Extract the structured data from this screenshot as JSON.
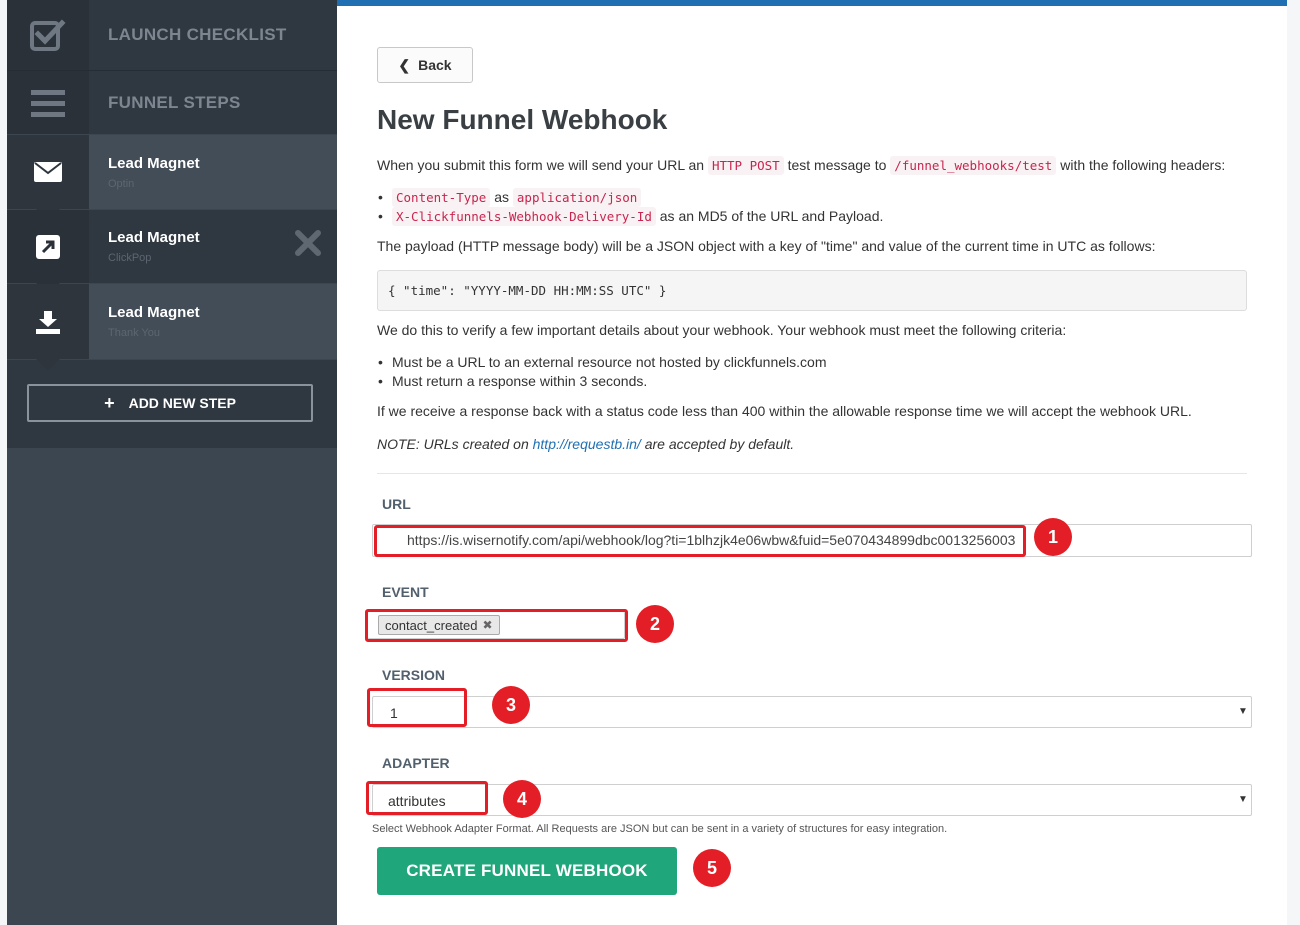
{
  "sidebar": {
    "launch_checklist": "LAUNCH CHECKLIST",
    "funnel_steps": "FUNNEL STEPS",
    "steps": [
      {
        "title": "Lead Magnet",
        "subtitle": "Optin",
        "icon": "envelope-icon"
      },
      {
        "title": "Lead Magnet",
        "subtitle": "ClickPop",
        "icon": "external-link-icon"
      },
      {
        "title": "Lead Magnet",
        "subtitle": "Thank You",
        "icon": "download-icon"
      }
    ],
    "add_step": "ADD NEW STEP"
  },
  "main": {
    "back": "Back",
    "title": "New Funnel Webhook",
    "intro": {
      "before": "When you submit this form we will send your URL an",
      "code1": "HTTP POST",
      "mid": "test message to",
      "code2": "/funnel_webhooks/test",
      "after": "with the following headers:"
    },
    "headers": [
      {
        "key": "Content-Type",
        "sep": "as",
        "value": "application/json"
      },
      {
        "key": "X-Clickfunnels-Webhook-Delivery-Id",
        "text": "as an MD5 of the URL and Payload."
      }
    ],
    "payload_text": "The payload (HTTP message body) will be a JSON object with a key of \"time\" and value of the current time in UTC as follows:",
    "payload_example": "{ \"time\": \"YYYY-MM-DD HH:MM:SS UTC\" }",
    "verify_text": "We do this to verify a few important details about your webhook. Your webhook must meet the following criteria:",
    "criteria": [
      "Must be a URL to an external resource not hosted by clickfunnels.com",
      "Must return a response within 3 seconds."
    ],
    "accept_text": "If we receive a response back with a status code less than 400 within the allowable response time we will accept the webhook URL.",
    "note": {
      "before": "NOTE: URLs created on",
      "link": "http://requestb.in/",
      "after": "are accepted by default."
    }
  },
  "form": {
    "url_label": "URL",
    "url_value": "https://is.wisernotify.com/api/webhook/log?ti=1blhzjk4e06wbw&fuid=5e070434899dbc0013256003",
    "event_label": "EVENT",
    "event_tag": "contact_created",
    "version_label": "VERSION",
    "version_value": "1",
    "adapter_label": "ADAPTER",
    "adapter_value": "attributes",
    "adapter_help": "Select Webhook Adapter Format. All Requests are JSON but can be sent in a variety of structures for easy integration.",
    "submit": "CREATE FUNNEL WEBHOOK"
  },
  "annotations": [
    "1",
    "2",
    "3",
    "4",
    "5"
  ],
  "colors": {
    "accent": "#1f6fb2",
    "submit": "#1fa67a",
    "highlight": "#e41e26",
    "sidebar": "#3c4651"
  }
}
